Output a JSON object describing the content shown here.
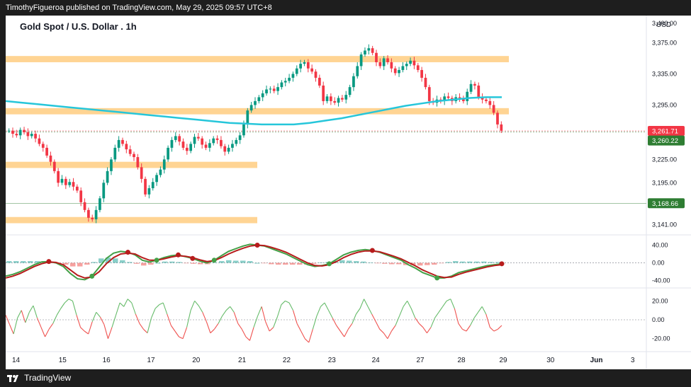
{
  "header": {
    "text": "TimothyFigueroa published on TradingView.com, May 29, 2025 09:57 UTC+8"
  },
  "footer": {
    "brand": "TradingView",
    "logo_icon": "tradingview-logo-icon"
  },
  "chart_data": [
    {
      "type": "candlestick",
      "title": "Gold Spot / U.S. Dollar . 1h",
      "currency_label": "USD",
      "y_ticks": [
        "3,400.00",
        "3,375.00",
        "3,335.00",
        "3,295.00",
        "3,225.00",
        "3,195.00",
        "3,141.00"
      ],
      "y_tick_values": [
        3400,
        3375,
        3335,
        3295,
        3225,
        3195,
        3141
      ],
      "ylim": [
        3128,
        3410
      ],
      "price_labels": [
        {
          "text": "3,261.71",
          "value": 3261.71,
          "color": "#f23645"
        },
        {
          "text": "3,260.22",
          "value": 3260.22,
          "color": "#2e7d32"
        },
        {
          "text": "3,168.66",
          "value": 3168.66,
          "color": "#2e7d32"
        }
      ],
      "zones": [
        {
          "from": 3350,
          "to": 3358,
          "start": 0,
          "end": 1.0
        },
        {
          "from": 3283,
          "to": 3291,
          "start": 0,
          "end": 1.0
        },
        {
          "from": 3214,
          "to": 3222,
          "start": 0,
          "end": 0.5
        },
        {
          "from": 3143,
          "to": 3151,
          "start": 0,
          "end": 0.5
        }
      ],
      "closes": [
        3262,
        3258,
        3256,
        3263,
        3260,
        3255,
        3258,
        3252,
        3245,
        3240,
        3230,
        3222,
        3210,
        3195,
        3200,
        3192,
        3196,
        3190,
        3185,
        3170,
        3160,
        3150,
        3148,
        3160,
        3175,
        3195,
        3210,
        3225,
        3240,
        3250,
        3245,
        3238,
        3232,
        3228,
        3215,
        3200,
        3180,
        3188,
        3196,
        3205,
        3212,
        3225,
        3240,
        3250,
        3255,
        3248,
        3240,
        3236,
        3245,
        3254,
        3252,
        3244,
        3240,
        3246,
        3252,
        3250,
        3242,
        3235,
        3240,
        3245,
        3250,
        3256,
        3270,
        3288,
        3295,
        3300,
        3305,
        3310,
        3315,
        3316,
        3313,
        3318,
        3324,
        3326,
        3330,
        3335,
        3342,
        3348,
        3350,
        3342,
        3338,
        3330,
        3320,
        3300,
        3306,
        3300,
        3298,
        3304,
        3302,
        3308,
        3318,
        3332,
        3345,
        3360,
        3365,
        3368,
        3362,
        3350,
        3345,
        3355,
        3350,
        3342,
        3336,
        3340,
        3345,
        3348,
        3352,
        3346,
        3340,
        3330,
        3318,
        3300,
        3298,
        3302,
        3300,
        3306,
        3304,
        3300,
        3305,
        3304,
        3300,
        3312,
        3322,
        3320,
        3305,
        3302,
        3300,
        3295,
        3285,
        3270,
        3262
      ],
      "ma_line": [
        3300,
        3298,
        3296,
        3294,
        3292,
        3290,
        3288,
        3286,
        3284,
        3282,
        3280,
        3278,
        3276,
        3274,
        3272,
        3271,
        3270,
        3270,
        3270,
        3272,
        3275,
        3278,
        3282,
        3286,
        3290,
        3294,
        3297,
        3300,
        3302,
        3304,
        3305,
        3305
      ],
      "x_ticks": [
        "14",
        "15",
        "16",
        "17",
        "20",
        "21",
        "22",
        "23",
        "24",
        "27",
        "28",
        "29",
        "30",
        "Jun",
        "3"
      ],
      "x_tick_pos": [
        0.015,
        0.083,
        0.147,
        0.212,
        0.278,
        0.345,
        0.41,
        0.476,
        0.54,
        0.605,
        0.665,
        0.726,
        0.795,
        0.862,
        0.915
      ]
    },
    {
      "type": "line",
      "y_ticks": [
        "40.00",
        "0.00",
        "-40.00"
      ],
      "y_tick_values": [
        40,
        0,
        -40
      ],
      "ylim": [
        -55,
        60
      ],
      "fast": [
        -30,
        -26,
        -20,
        -12,
        -4,
        2,
        3,
        0,
        -8,
        -24,
        -36,
        -38,
        -30,
        -10,
        10,
        22,
        26,
        24,
        18,
        6,
        2,
        6,
        12,
        16,
        18,
        14,
        10,
        4,
        0,
        6,
        16,
        26,
        32,
        38,
        42,
        40,
        38,
        32,
        26,
        20,
        12,
        4,
        -4,
        -8,
        -6,
        -2,
        8,
        18,
        24,
        28,
        30,
        28,
        24,
        18,
        12,
        6,
        -4,
        -12,
        -22,
        -28,
        -34,
        -34,
        -30,
        -22,
        -18,
        -14,
        -10,
        -6,
        -4,
        -2
      ],
      "slow": [
        -34,
        -30,
        -24,
        -16,
        -8,
        -2,
        2,
        1,
        -4,
        -16,
        -28,
        -34,
        -32,
        -20,
        -2,
        12,
        20,
        22,
        20,
        12,
        6,
        6,
        9,
        13,
        16,
        15,
        12,
        7,
        3,
        5,
        12,
        20,
        27,
        33,
        38,
        40,
        39,
        35,
        30,
        24,
        16,
        8,
        0,
        -6,
        -7,
        -4,
        3,
        12,
        19,
        24,
        27,
        27,
        25,
        20,
        15,
        9,
        1,
        -7,
        -16,
        -23,
        -30,
        -33,
        -32,
        -26,
        -21,
        -17,
        -13,
        -9,
        -6,
        -4
      ],
      "histogram": [
        4,
        4,
        4,
        4,
        4,
        4,
        1,
        -1,
        -4,
        -8,
        -8,
        -4,
        2,
        10,
        12,
        10,
        6,
        2,
        -2,
        -6,
        -4,
        0,
        3,
        3,
        2,
        -1,
        -2,
        -3,
        -3,
        1,
        4,
        6,
        5,
        5,
        4,
        0,
        -1,
        -3,
        -4,
        -4,
        -4,
        -4,
        -4,
        -2,
        1,
        2,
        5,
        6,
        5,
        4,
        3,
        1,
        -1,
        -2,
        -3,
        -3,
        -5,
        -5,
        -6,
        -5,
        -4,
        -1,
        2,
        4,
        3,
        3,
        3,
        3,
        2,
        2
      ],
      "cross_markers": [
        {
          "index": 6,
          "color": "#b71c1c"
        },
        {
          "index": 12,
          "color": "#43a047"
        },
        {
          "index": 17,
          "color": "#b71c1c"
        },
        {
          "index": 21,
          "color": "#43a047"
        },
        {
          "index": 24,
          "color": "#b71c1c"
        },
        {
          "index": 26,
          "color": "#b71c1c"
        },
        {
          "index": 29,
          "color": "#43a047"
        },
        {
          "index": 35,
          "color": "#b71c1c"
        },
        {
          "index": 45,
          "color": "#43a047"
        },
        {
          "index": 51,
          "color": "#b71c1c"
        },
        {
          "index": 60,
          "color": "#43a047"
        },
        {
          "index": 69,
          "color": "#b71c1c"
        }
      ]
    },
    {
      "type": "line",
      "y_ticks": [
        "20.00",
        "0.00",
        "-20.00"
      ],
      "y_tick_values": [
        20,
        0,
        -20
      ],
      "ylim": [
        -30,
        30
      ],
      "values": [
        5,
        -5,
        -15,
        2,
        10,
        -3,
        8,
        15,
        2,
        -8,
        -18,
        -10,
        -4,
        5,
        12,
        18,
        22,
        20,
        5,
        -8,
        -12,
        -15,
        -2,
        8,
        3,
        -5,
        -20,
        -8,
        5,
        18,
        14,
        22,
        18,
        6,
        -4,
        -10,
        -14,
        2,
        12,
        16,
        18,
        6,
        -6,
        -12,
        -18,
        -20,
        -8,
        10,
        20,
        15,
        8,
        -2,
        -14,
        -10,
        -4,
        4,
        10,
        14,
        8,
        -4,
        -10,
        -18,
        -22,
        -8,
        4,
        14,
        -2,
        -12,
        -8,
        3,
        16,
        20,
        18,
        10,
        -4,
        -12,
        -20,
        -24,
        -10,
        4,
        14,
        18,
        10,
        2,
        -6,
        -12,
        -18,
        -10,
        -4,
        6,
        12,
        22,
        14,
        6,
        -2,
        -10,
        -14,
        -20,
        -12,
        -6,
        4,
        14,
        20,
        12,
        2,
        -4,
        -8,
        -14,
        -8,
        2,
        8,
        14,
        20,
        22,
        12,
        -4,
        -10,
        -12,
        -6,
        2,
        8,
        14,
        6,
        -8,
        -12,
        -10,
        -6
      ],
      "up_color": "#66bb6a",
      "down_color": "#ef5350"
    }
  ]
}
